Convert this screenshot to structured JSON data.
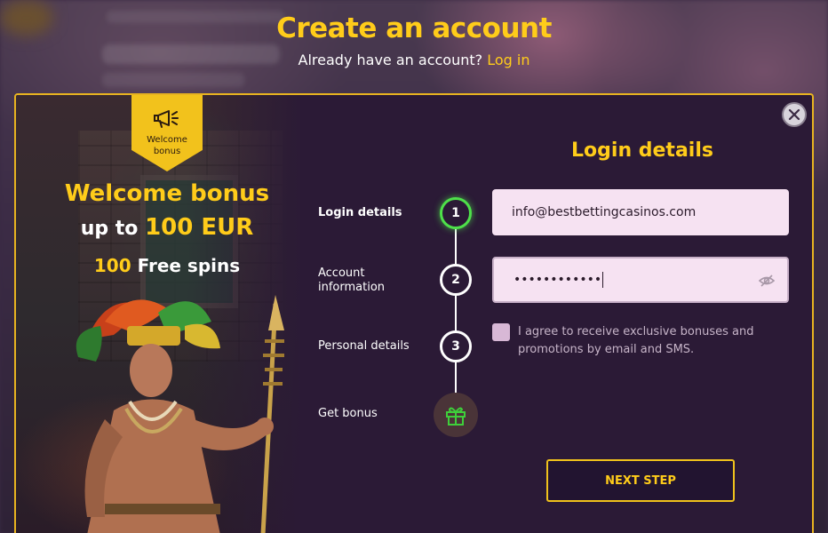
{
  "header": {
    "title": "Create an account",
    "subtitle": "Already have an account?",
    "login_link": "Log in"
  },
  "promo": {
    "badge_label": "Welcome bonus",
    "line1": "Welcome bonus",
    "line2_prefix": "up to",
    "line2_amount": "100 EUR",
    "line3_count": "100",
    "line3_text": "Free spins"
  },
  "steps": [
    {
      "label": "Login details",
      "number": "1",
      "state": "active"
    },
    {
      "label": "Account information",
      "number": "2",
      "state": "pending"
    },
    {
      "label": "Personal details",
      "number": "3",
      "state": "pending"
    },
    {
      "label": "Get bonus",
      "icon": "gift-icon",
      "state": "pending"
    }
  ],
  "form": {
    "title": "Login details",
    "email_value": "info@bestbettingcasinos.com",
    "password_masked": "••••••••••••",
    "consent_text": "I agree to receive exclusive bonuses and promotions by email and SMS.",
    "next_label": "NEXT STEP"
  },
  "colors": {
    "accent": "#ffcc1a",
    "modal_bg": "#2b1a36",
    "active_step": "#4ee04a",
    "input_bg": "#f6e2f2"
  },
  "icons": [
    "megaphone-icon",
    "close-icon",
    "eye-off-icon",
    "gift-icon"
  ]
}
